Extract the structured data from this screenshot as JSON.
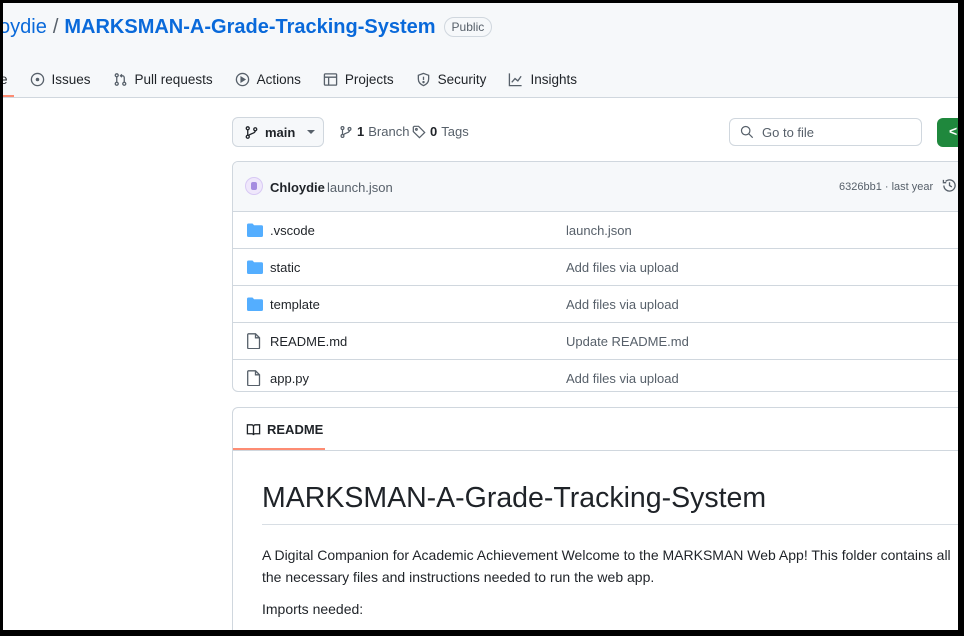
{
  "repo": {
    "owner": "Chloydie",
    "owner_visible": "oydie",
    "separator": "/",
    "name": "MARKSMAN-A-Grade-Tracking-System",
    "visibility": "Public"
  },
  "nav": {
    "code_partial": "e",
    "issues": "Issues",
    "pull_requests": "Pull requests",
    "actions": "Actions",
    "projects": "Projects",
    "security": "Security",
    "insights": "Insights"
  },
  "toolbar": {
    "branch": "main",
    "branch_count": "1",
    "branch_label": "Branch",
    "tag_count": "0",
    "tag_label": "Tags",
    "go_to_file_placeholder": "Go to file",
    "code_button_glyph": "<"
  },
  "commit": {
    "author": "Chloydie",
    "message": "launch.json",
    "hash_time": "6326bb1 · last year"
  },
  "files": [
    {
      "name": ".vscode",
      "type": "folder",
      "message": "launch.json"
    },
    {
      "name": "static",
      "type": "folder",
      "message": "Add files via upload"
    },
    {
      "name": "template",
      "type": "folder",
      "message": "Add files via upload"
    },
    {
      "name": "README.md",
      "type": "file",
      "message": "Update README.md"
    },
    {
      "name": "app.py",
      "type": "file",
      "message": "Add files via upload"
    }
  ],
  "readme": {
    "tab_label": "README",
    "title": "MARKSMAN-A-Grade-Tracking-System",
    "paragraph": "A Digital Companion for Academic Achievement Welcome to the MARKSMAN Web App! This folder contains all the necessary files and instructions needed to run the web app.",
    "imports_heading": "Imports needed:"
  },
  "colors": {
    "link": "#0969da",
    "folder": "#54aeff",
    "accent_underline": "#fd8c73",
    "green_button": "#1f883d"
  }
}
